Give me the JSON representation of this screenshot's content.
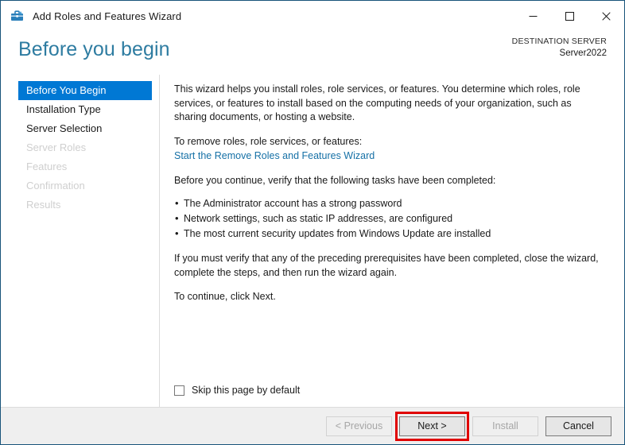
{
  "window": {
    "title": "Add Roles and Features Wizard",
    "icon": "wizard-toolbox-icon",
    "controls": {
      "minimize": "—",
      "maximize": "□",
      "close": "✕"
    },
    "border_color": "#18547a"
  },
  "header": {
    "page_title": "Before you begin",
    "page_title_color": "#2e7ca1",
    "destination_label": "DESTINATION SERVER",
    "destination_value": "Server2022"
  },
  "sidebar": {
    "items": [
      {
        "label": "Before You Begin",
        "state": "selected"
      },
      {
        "label": "Installation Type",
        "state": "enabled"
      },
      {
        "label": "Server Selection",
        "state": "enabled"
      },
      {
        "label": "Server Roles",
        "state": "disabled"
      },
      {
        "label": "Features",
        "state": "disabled"
      },
      {
        "label": "Confirmation",
        "state": "disabled"
      },
      {
        "label": "Results",
        "state": "disabled"
      }
    ],
    "selected_background": "#0078d4"
  },
  "content": {
    "intro": "This wizard helps you install roles, role services, or features. You determine which roles, role services, or features to install based on the computing needs of your organization, such as sharing documents, or hosting a website.",
    "remove_prompt": "To remove roles, role services, or features:",
    "remove_link": "Start the Remove Roles and Features Wizard",
    "remove_link_color": "#1570a6",
    "verify_prompt": "Before you continue, verify that the following tasks have been completed:",
    "tasks": [
      "The Administrator account has a strong password",
      "Network settings, such as static IP addresses, are configured",
      "The most current security updates from Windows Update are installed"
    ],
    "prereq_note": "If you must verify that any of the preceding prerequisites have been completed, close the wizard, complete the steps, and then run the wizard again.",
    "continue_note": "To continue, click Next.",
    "skip_checkbox_label": "Skip this page by default",
    "skip_checkbox_checked": false
  },
  "footer": {
    "buttons": [
      {
        "label": "< Previous",
        "state": "disabled",
        "highlighted": false
      },
      {
        "label": "Next >",
        "state": "enabled",
        "highlighted": true
      },
      {
        "label": "Install",
        "state": "disabled",
        "highlighted": false
      },
      {
        "label": "Cancel",
        "state": "enabled",
        "highlighted": false
      }
    ],
    "highlight_color": "#e00000"
  }
}
